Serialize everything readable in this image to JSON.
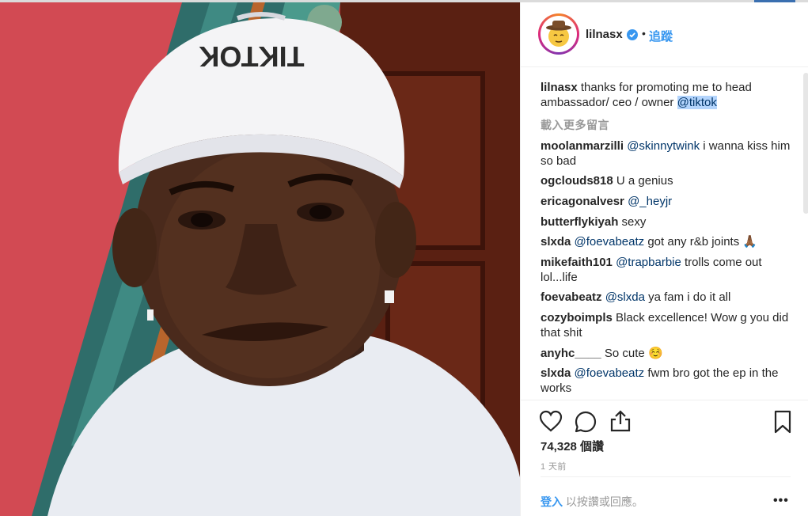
{
  "colors": {
    "accent_link": "#3897f0",
    "mention": "#003569",
    "muted": "#999999",
    "text": "#262626",
    "selection": "#b3d4fc"
  },
  "post": {
    "photo": {
      "cap_text": "TIKTOK"
    },
    "header": {
      "username": "lilnasx",
      "separator": "•",
      "follow_label": "追蹤",
      "verified_icon": "verified-badge-icon"
    },
    "caption": {
      "user": "lilnasx",
      "text": "thanks for promoting me to head ambassador/ ceo / owner",
      "mention": "@tiktok"
    },
    "load_more": "載入更多留言",
    "comments": [
      {
        "user": "moolanmarzilli",
        "mention": "@skinnytwink",
        "text": "i wanna kiss him so bad"
      },
      {
        "user": "ogclouds818",
        "mention": "",
        "text": "U a genius"
      },
      {
        "user": "ericagonalvesr",
        "mention": "@_heyjr",
        "text": ""
      },
      {
        "user": "butterflykiyah",
        "mention": "",
        "text": "sexy"
      },
      {
        "user": "slxda",
        "mention": "@foevabeatz",
        "text": "got any r&b joints 🙏🏾"
      },
      {
        "user": "mikefaith101",
        "mention": "@trapbarbie",
        "text": "trolls come out lol...life"
      },
      {
        "user": "foevabeatz",
        "mention": "@slxda",
        "text": "ya fam i do it all"
      },
      {
        "user": "cozyboimpls",
        "mention": "",
        "text": "Black excellence! Wow g you did that shit"
      },
      {
        "user": "anyhc____",
        "mention": "",
        "text": "So cute ☺️"
      },
      {
        "user": "slxda",
        "mention": "@foevabeatz",
        "text": "fwm bro got the ep in the works"
      }
    ],
    "actions": {
      "like_icon": "heart-icon",
      "comment_icon": "comment-bubble-icon",
      "share_icon": "share-upload-icon",
      "save_icon": "bookmark-icon"
    },
    "likes": "74,328 個讚",
    "time_ago": "1 天前",
    "footer": {
      "login_link": "登入",
      "login_suffix": "以按讚或回應。",
      "more_label": "•••"
    }
  }
}
